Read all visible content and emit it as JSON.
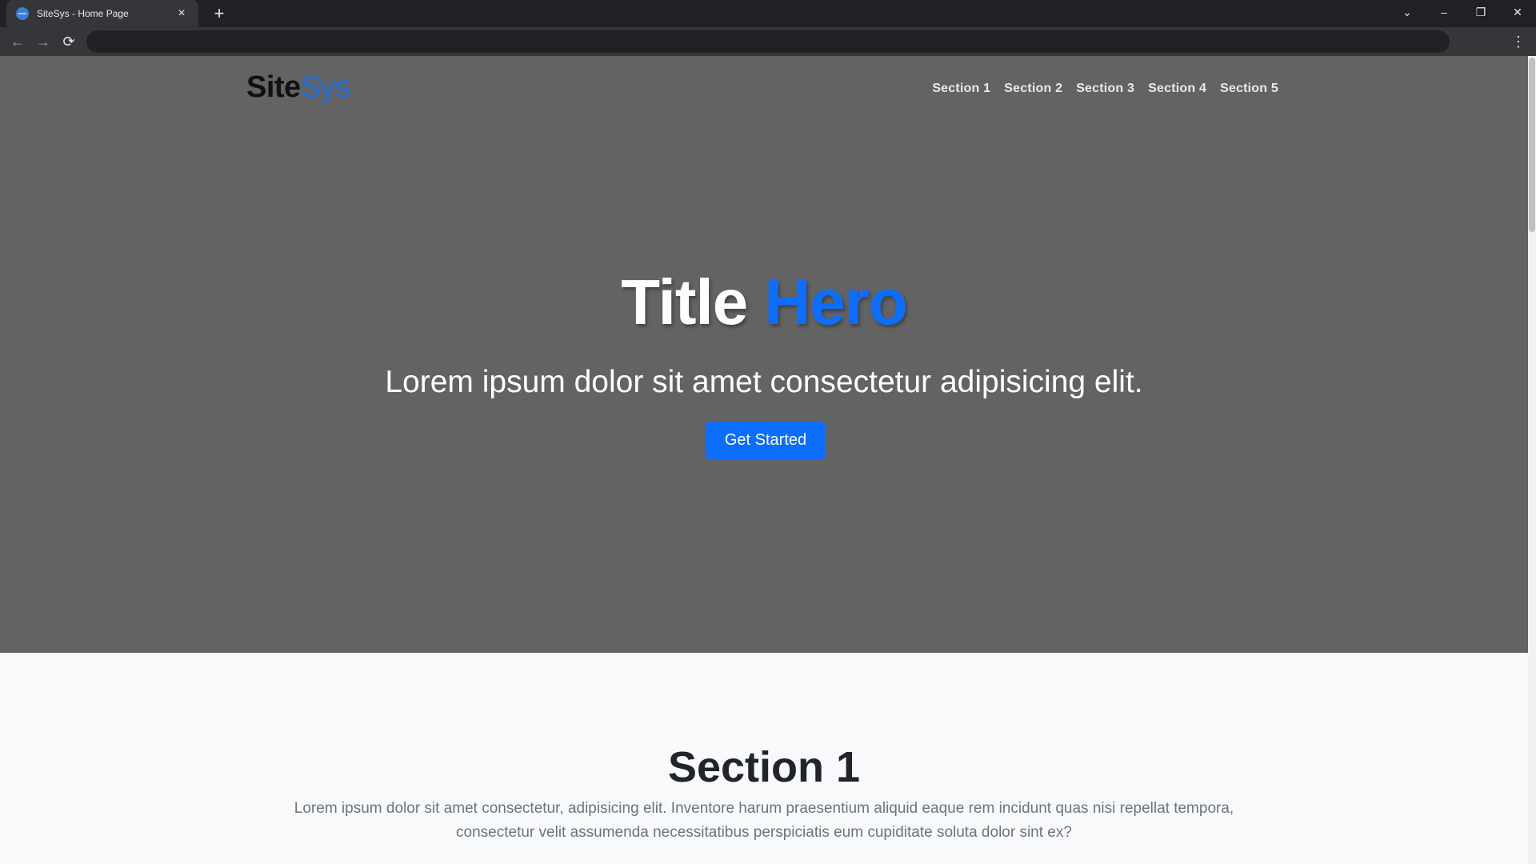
{
  "browser": {
    "tab_title": "SiteSys - Home Page",
    "tab_close": "×",
    "new_tab": "+",
    "address": "",
    "controls": {
      "tabs_dropdown": "⌄",
      "minimize": "–",
      "restore": "❐",
      "close": "✕"
    },
    "nav": {
      "back": "←",
      "forward": "→",
      "reload": "⟳",
      "menu": "⋮"
    }
  },
  "site": {
    "logo": {
      "part1": "Site",
      "part2": "Sys"
    },
    "nav_links": [
      "Section 1",
      "Section 2",
      "Section 3",
      "Section 4",
      "Section 5"
    ],
    "hero": {
      "title_part1": "Title",
      "title_part2": "Hero",
      "subtitle": "Lorem ipsum dolor sit amet consectetur adipisicing elit.",
      "cta_label": "Get Started"
    },
    "section1": {
      "title": "Section 1",
      "text": "Lorem ipsum dolor sit amet consectetur, adipisicing elit. Inventore harum praesentium aliquid eaque rem incidunt quas nisi repellat tempora, consectetur velit assumenda necessitatibus perspiciatis eum cupiditate soluta dolor sint ex?"
    }
  },
  "colors": {
    "hero_bg": "#636363",
    "accent": "#0d6efd",
    "page_bg": "#f8f9fa"
  }
}
